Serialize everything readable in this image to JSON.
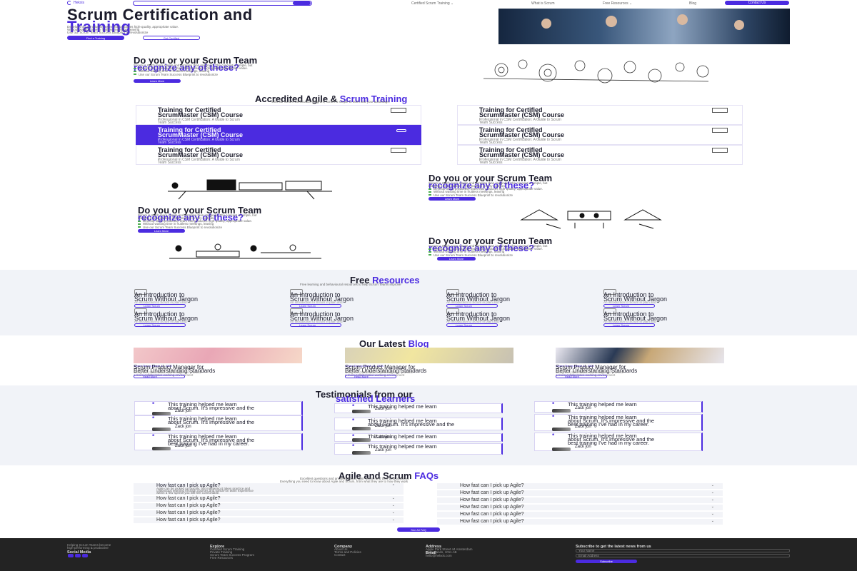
{
  "header": {
    "brand": "Hekxis",
    "nav": [
      "Certified Scrum Training ⌄",
      "What is Scrum",
      "Free Resources ⌄",
      "Blog"
    ],
    "contact_label": "Contact Us"
  },
  "hero": {
    "title_line1": "Scrum Certification and",
    "title_line2": "Training",
    "bullets": [
      "Develop into a productive team that produces high-quality, appropriate value.",
      "Without wasting time in fruitless meetings, leaving",
      "Use our Scrum Team Success Blueprint to revolutionize"
    ],
    "btn_primary": "Find a Training",
    "btn_secondary": "Get Certified"
  },
  "ask_block": {
    "title_a": "Do you or your Scrum Team",
    "title_b": "recognize any of these?",
    "desc": "Scrum is much more simple and complex than imagined. The concept is simple, but",
    "desc2": "bringing it into practice, it into practice is very complex.",
    "bullets": [
      "Develop into a productive team that produces high-quality, appropriate value.",
      "Without wasting time in fruitless meetings, leaving",
      "Use our Scrum Team Success Blueprint to revolutionize"
    ],
    "btn": "Learn More"
  },
  "training": {
    "title_a": "Accredited Agile &",
    "title_b": "Scrum Training",
    "subtitle": "With our Scrum Certification program, scrum is simple to learn and your advantage.",
    "card_title_1": "Training for Certified",
    "card_title_2": "ScrumMaster (CSM) Course",
    "card_desc_1": "Professional in CSM Certification: A Guide to Scrum",
    "card_desc_2": "Team Success"
  },
  "resources": {
    "title_a": "Free",
    "title_b": "Resources",
    "subtitle": "Free learning and behavioural resources to help Scrum Teams improve",
    "card_title_1": "An Introduction to",
    "card_title_2": "Scrum Without Jargon",
    "card_desc_1": "An introduction to Scrum in plain and",
    "card_desc_2": "simple words",
    "card_btn": "Learn Scrum"
  },
  "blog": {
    "title_a": "Our Latest",
    "title_b": "Blog",
    "tag": "Scrum Theory     March 11, 2023",
    "post_title_1": "Scrum Product Manager for",
    "post_title_2": "Better Understanding Standards",
    "post_desc_1": "Using our collaboration technologies to promote",
    "post_desc_2": "a more collaborative working environment",
    "btn": "Read More"
  },
  "testimonials": {
    "title_a": "Testimonials from our",
    "title_b": "satisfied Learners",
    "quote_1": "This training helped me learn",
    "quote_2": "about Scrum. It's impressive and the",
    "quote_3": "best training I've had in my career.",
    "name": "Zack jon"
  },
  "faq": {
    "title_a": "Agile and Scrum",
    "title_b": "FAQs",
    "subtitle_1": "Excellent questions and answers about Agile, Scrum and their best practices",
    "subtitle_2": "Everything you need to know about Agile and Scrum, from what they are to how they work",
    "question": "How fast can I pick up Agile?",
    "answer_1": "Agile can be picked up quickly, but mastering it takes practice and",
    "answer_2": "continuous learning through courses and hands-on team experience",
    "answer_3": "within a few sprints you will feel comfortable.",
    "btn": "See All FAQ"
  },
  "footer": {
    "about_1": "Helping Scrum Teams become",
    "about_2": "high-performing & productive",
    "social": "Social Media",
    "col_explore": "Explore",
    "explore_links": [
      "Certified Scrum Training",
      "Private Training",
      "Scrum Team Success Program",
      "Free Resources"
    ],
    "col_company": "Company",
    "company_links": [
      "About Us",
      "Terms and Policies",
      "Contact"
    ],
    "col_address": "Address",
    "address_1": "Apple Park Street 44 Amsterdam",
    "address_2": "Netherlands, 1011 AB",
    "email_label": "Email",
    "email": "hello@hekxis.com",
    "newsletter_title": "Subscribe to get the latest news from us",
    "name_placeholder": "Your Name",
    "email_placeholder": "Email Address",
    "subscribe": "Subscribe"
  },
  "colors": {
    "accent": "#4b2be0",
    "band": "#f1f3f8",
    "footer": "#232323",
    "check": "#4caf50"
  }
}
